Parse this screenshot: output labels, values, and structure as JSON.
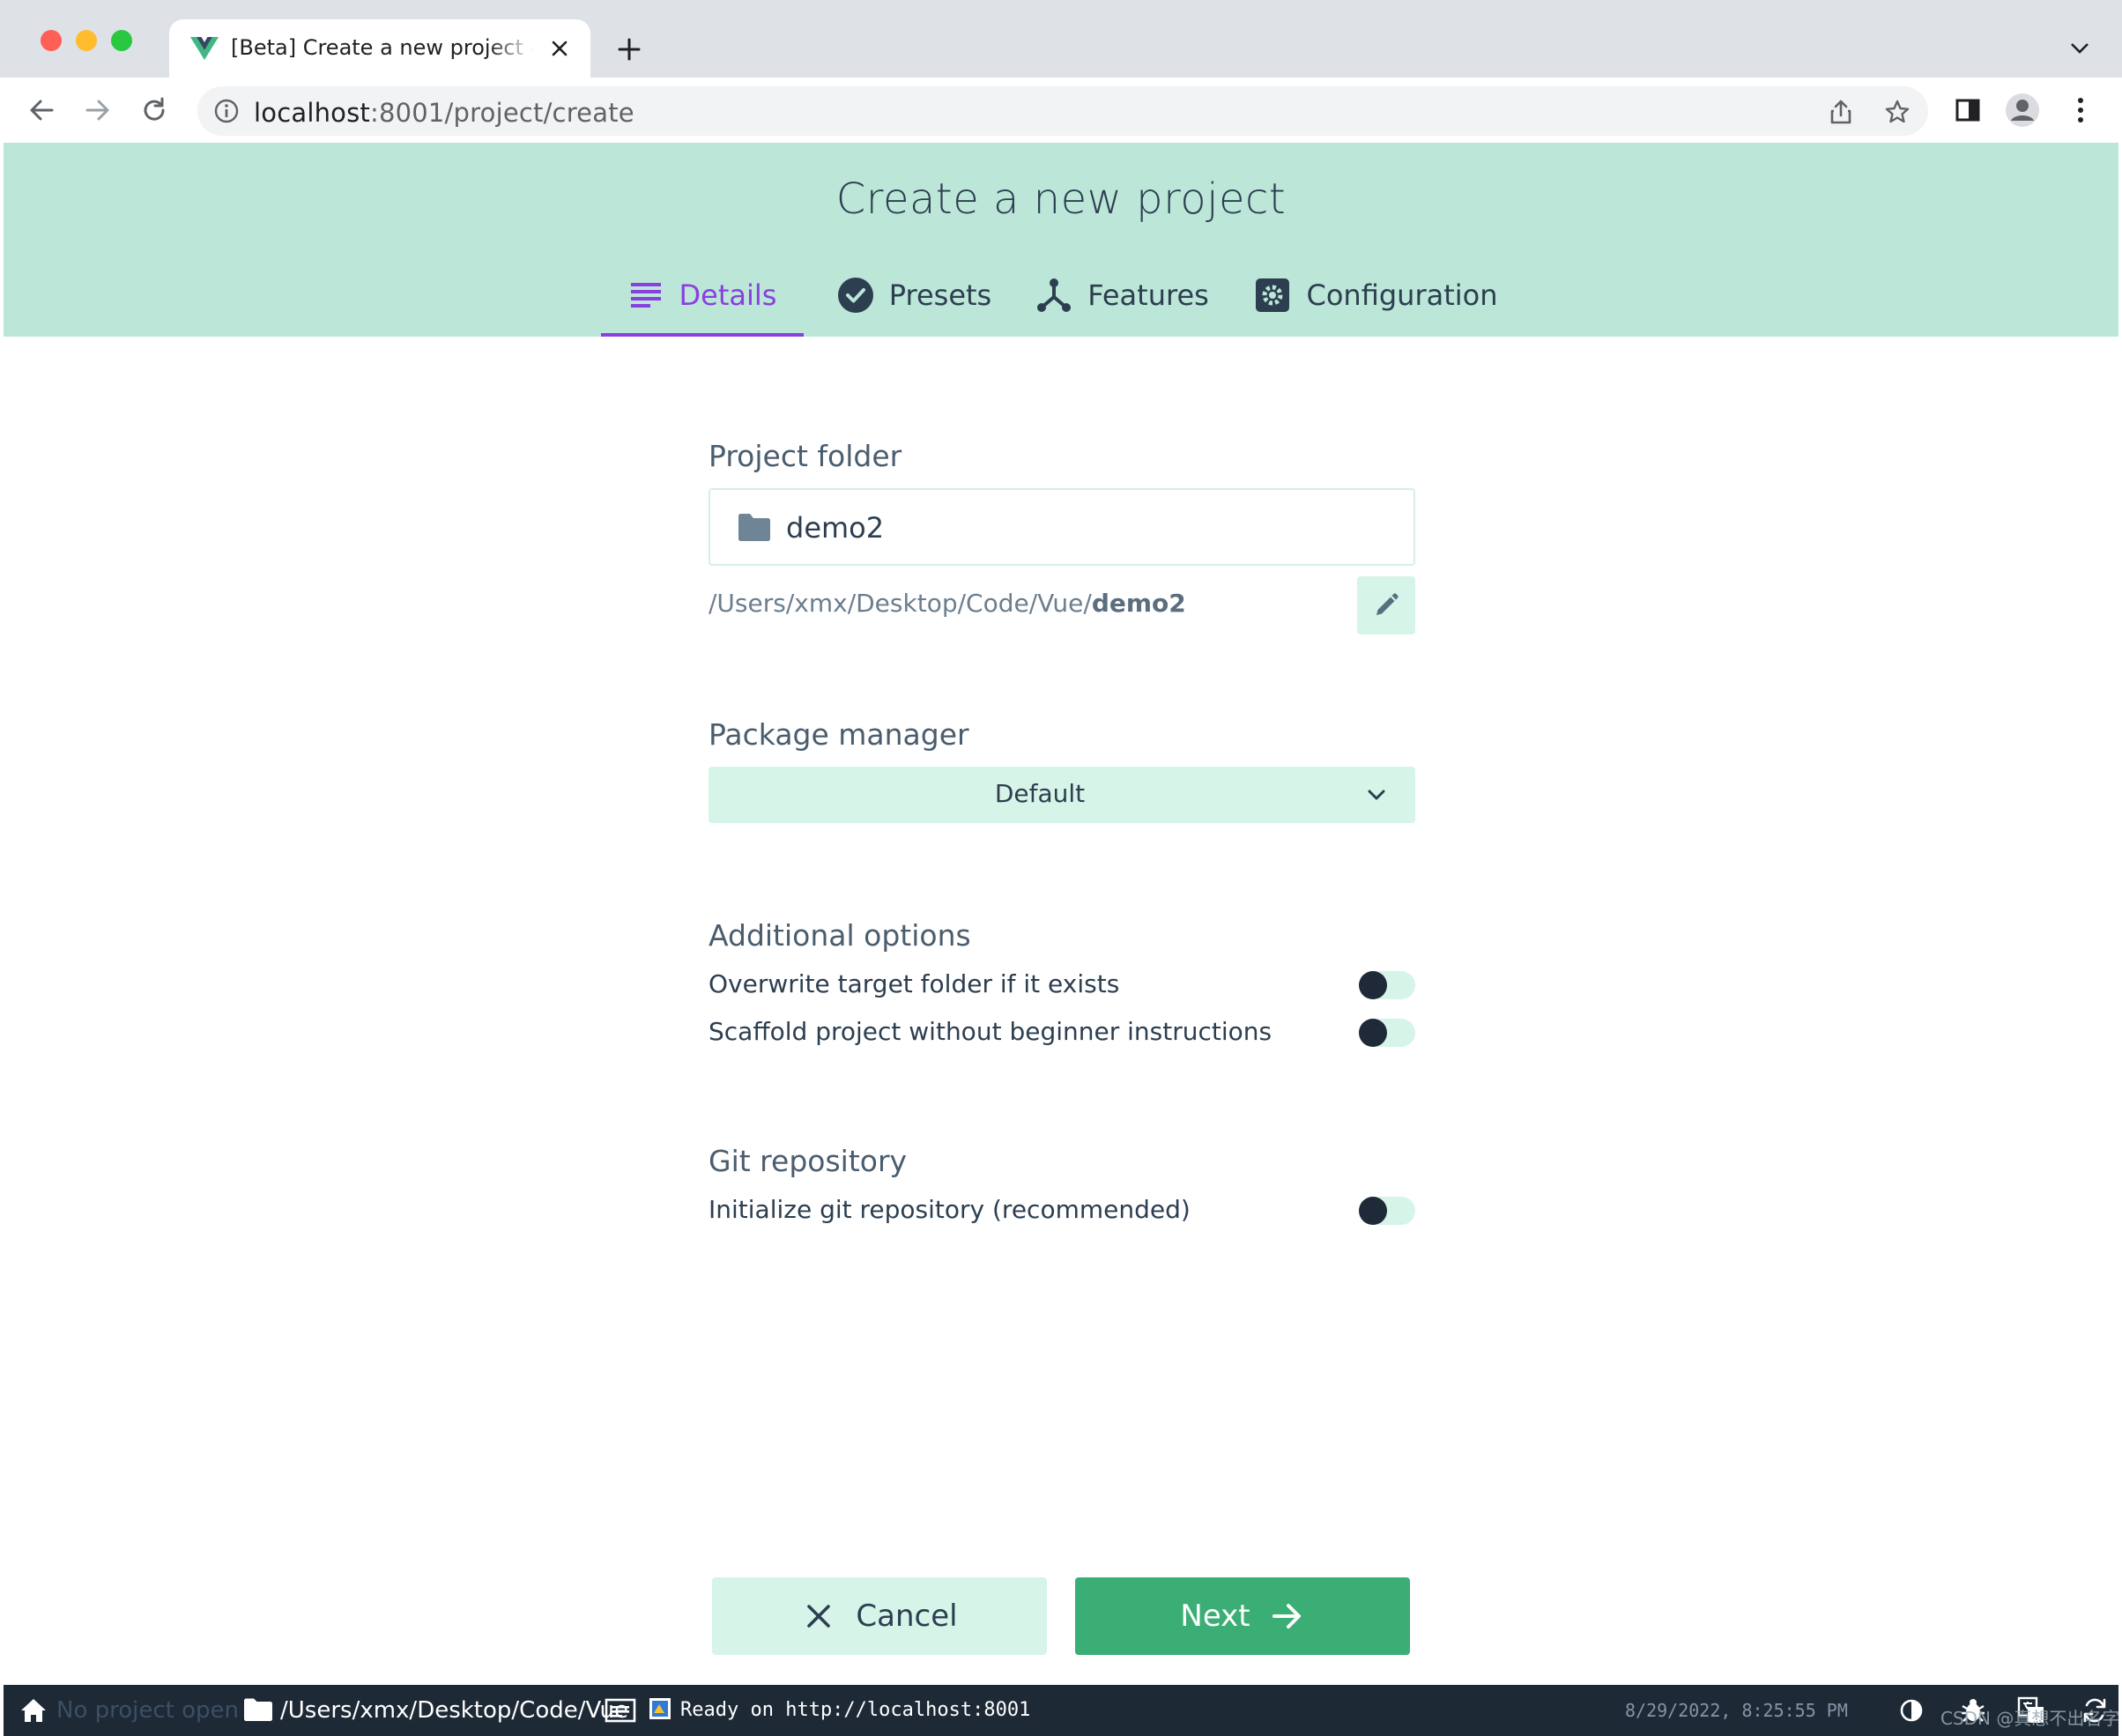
{
  "browser": {
    "tab_title": "[Beta] Create a new project - Vue CLI",
    "url_host": "localhost",
    "url_rest": ":8001/project/create"
  },
  "header": {
    "title": "Create a new project",
    "tabs": [
      {
        "label": "Details",
        "icon": "list-icon",
        "active": true
      },
      {
        "label": "Presets",
        "icon": "check-circle-icon",
        "active": false
      },
      {
        "label": "Features",
        "icon": "fork-icon",
        "active": false
      },
      {
        "label": "Configuration",
        "icon": "settings-icon",
        "active": false
      }
    ]
  },
  "form": {
    "project_folder": {
      "label": "Project folder",
      "value": "demo2",
      "path_prefix": "/Users/xmx/Desktop/Code/Vue/",
      "path_name": "demo2"
    },
    "package_manager": {
      "label": "Package manager",
      "value": "Default"
    },
    "additional_options": {
      "label": "Additional options",
      "options": [
        {
          "label": "Overwrite target folder if it exists",
          "enabled": false
        },
        {
          "label": "Scaffold project without beginner instructions",
          "enabled": false
        }
      ]
    },
    "git": {
      "label": "Git repository",
      "options": [
        {
          "label": "Initialize git repository (recommended)",
          "enabled": false
        }
      ]
    }
  },
  "actions": {
    "cancel_label": "Cancel",
    "next_label": "Next"
  },
  "statusbar": {
    "no_project": "No project open",
    "path": "/Users/xmx/Desktop/Code/Vue",
    "ready": "Ready on http://localhost:8001",
    "timestamp": "8/29/2022, 8:25:55 PM"
  },
  "watermark": "CSDN @真想不出名字",
  "colors": {
    "header_bg": "#bce6d8",
    "accent_purple": "#8a3fe0",
    "primary_green": "#3aae74",
    "light_green": "#d7f4e8",
    "statusbar_bg": "#1d2935"
  }
}
